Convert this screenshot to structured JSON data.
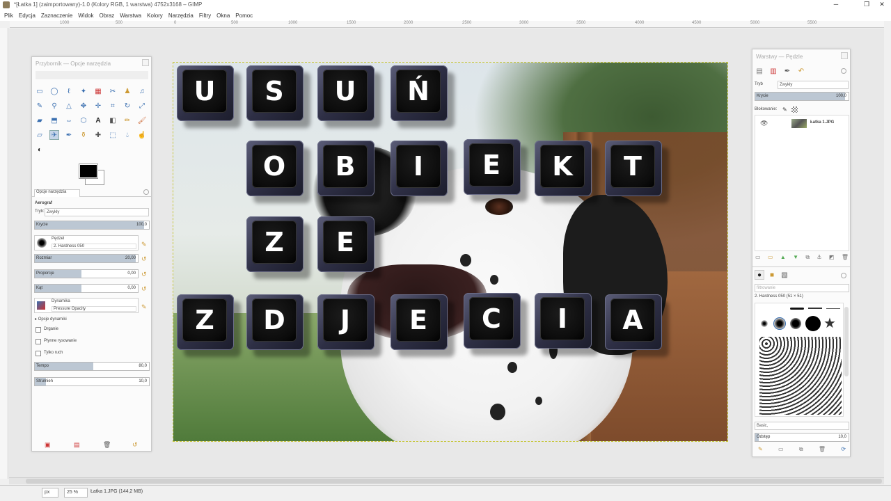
{
  "window": {
    "title": "*[Łatka 1] (zaimportowany)-1.0 (Kolory RGB, 1 warstwa) 4752x3168 – GIMP",
    "minimize": "─",
    "maximize": "❐",
    "close": "✕"
  },
  "menu": [
    "Plik",
    "Edycja",
    "Zaznaczenie",
    "Widok",
    "Obraz",
    "Warstwa",
    "Kolory",
    "Narzędzia",
    "Filtry",
    "Okna",
    "Pomoc"
  ],
  "ruler": {
    "labels": [
      "1000",
      "500",
      "0",
      "500",
      "1000",
      "1500",
      "2000",
      "2500",
      "3000",
      "3500",
      "4000",
      "4500",
      "5000",
      "5500"
    ]
  },
  "overlay_words": [
    [
      "U",
      "S",
      "U",
      "Ń"
    ],
    [
      "O",
      "B",
      "I",
      "E",
      "K",
      "T"
    ],
    [
      "Z",
      "E"
    ],
    [
      "Z",
      "D",
      "J",
      "E",
      "C",
      "I",
      "A"
    ]
  ],
  "toolbox": {
    "title": "Przybornik — Opcje narzędzia",
    "tab_label": "Opcje narzędzia",
    "tool_name": "Aerograf",
    "mode_label": "Tryb:",
    "mode_value": "Zwykły",
    "opacity_label": "Krycie",
    "opacity_value": "100,0",
    "brush_label": "Pędzel",
    "brush_value": "2. Hardness 050",
    "size_label": "Rozmiar",
    "size_value": "20,00",
    "size_fraction": 0.98,
    "aspect_label": "Proporcje",
    "aspect_value": "0,00",
    "aspect_fraction": 0.45,
    "angle_label": "Kąt",
    "angle_value": "0,00",
    "angle_fraction": 0.45,
    "dynamics_label": "Dynamika",
    "dynamics_value": "Pressure Opacity",
    "dyn_options": "Opcje dynamiki",
    "jitter": "Drganie",
    "smooth": "Płynne rysowanie",
    "incremental": "Tylko ruch",
    "rate_label": "Tempo",
    "rate_value": "80,0",
    "rate_fraction": 0.51,
    "flow_label": "Strumień",
    "flow_value": "10,0",
    "flow_fraction": 0.1
  },
  "layers": {
    "title": "Warstwy — Pędzle",
    "mode_label": "Tryb",
    "mode_value": "Zwykły",
    "opacity_label": "Krycie",
    "opacity_value": "100,0",
    "lock_label": "Blokowanie:",
    "layer_name": "Łatka 1.JPG",
    "filter_placeholder": "filtrowanie",
    "brush_info": "2. Hardness 050 (51 × 51)",
    "brush_tag": "Basic,",
    "spacing_label": "Odstęp",
    "spacing_value": "10,0"
  },
  "status": {
    "unit": "px",
    "zoom": "25 %",
    "info": "Łatka 1.JPG (144,2 MB)"
  },
  "colors": {
    "key_body": "#2e2f45",
    "key_face": "#0c0c0c",
    "accent": "#3a6fb0"
  }
}
